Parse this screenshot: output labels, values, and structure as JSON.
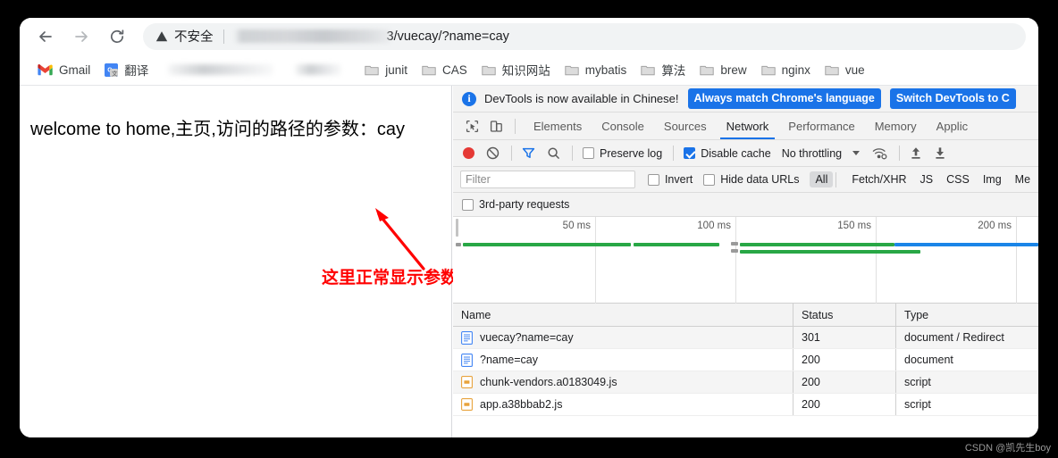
{
  "browser": {
    "nav": {
      "back_label": "Back",
      "forward_label": "Forward",
      "reload_label": "Reload"
    },
    "omnibox": {
      "security_label": "不安全",
      "url_visible": "3/vuecay/?name=cay",
      "url_hidden": true
    },
    "bookmarks": [
      {
        "label": "Gmail",
        "icon": "gmail-icon"
      },
      {
        "label": "翻译",
        "icon": "google-translate-icon"
      },
      {
        "label": "",
        "icon": "blurred-bookmark"
      },
      {
        "label": "",
        "icon": "blurred-bookmark"
      },
      {
        "label": "junit",
        "icon": "folder-icon"
      },
      {
        "label": "CAS",
        "icon": "folder-icon"
      },
      {
        "label": "知识网站",
        "icon": "folder-icon"
      },
      {
        "label": "mybatis",
        "icon": "folder-icon"
      },
      {
        "label": "算法",
        "icon": "folder-icon"
      },
      {
        "label": "brew",
        "icon": "folder-icon"
      },
      {
        "label": "nginx",
        "icon": "folder-icon"
      },
      {
        "label": "vue",
        "icon": "folder-icon"
      }
    ]
  },
  "page": {
    "body_text": "welcome to home,主页,访问的路径的参数：cay",
    "annotation_text": "这里正常显示参数",
    "annotation_color": "#ff0000"
  },
  "devtools": {
    "banner": {
      "message": "DevTools is now available in Chinese!",
      "primary_button": "Always match Chrome's language",
      "secondary_button": "Switch DevTools to C",
      "accent_color": "#1a73e8"
    },
    "tabs": [
      {
        "label": "Elements",
        "active": false
      },
      {
        "label": "Console",
        "active": false
      },
      {
        "label": "Sources",
        "active": false
      },
      {
        "label": "Network",
        "active": true
      },
      {
        "label": "Performance",
        "active": false
      },
      {
        "label": "Memory",
        "active": false
      },
      {
        "label": "Applic",
        "active": false
      }
    ],
    "toolbar": {
      "preserve_log_label": "Preserve log",
      "preserve_log_checked": false,
      "disable_cache_label": "Disable cache",
      "disable_cache_checked": true,
      "throttling_value": "No throttling"
    },
    "filter_bar": {
      "filter_placeholder": "Filter",
      "filter_value": "",
      "invert_label": "Invert",
      "invert_checked": false,
      "hide_data_urls_label": "Hide data URLs",
      "hide_data_urls_checked": false,
      "types": [
        {
          "label": "All",
          "selected": true
        },
        {
          "label": "Fetch/XHR",
          "selected": false
        },
        {
          "label": "JS",
          "selected": false
        },
        {
          "label": "CSS",
          "selected": false
        },
        {
          "label": "Img",
          "selected": false
        },
        {
          "label": "Me",
          "selected": false
        }
      ]
    },
    "third_party": {
      "label": "3rd-party requests",
      "checked": false
    },
    "overview": {
      "ticks": [
        "50 ms",
        "100 ms",
        "150 ms",
        "200 ms"
      ]
    },
    "requests": {
      "columns": [
        "Name",
        "Status",
        "Type"
      ],
      "rows": [
        {
          "name": "vuecay?name=cay",
          "status": "301",
          "type": "document / Redirect",
          "icon": "document-icon"
        },
        {
          "name": "?name=cay",
          "status": "200",
          "type": "document",
          "icon": "document-icon"
        },
        {
          "name": "chunk-vendors.a0183049.js",
          "status": "200",
          "type": "script",
          "icon": "script-icon"
        },
        {
          "name": "app.a38bbab2.js",
          "status": "200",
          "type": "script",
          "icon": "script-icon"
        }
      ]
    }
  },
  "watermark": "CSDN @凯先生boy"
}
